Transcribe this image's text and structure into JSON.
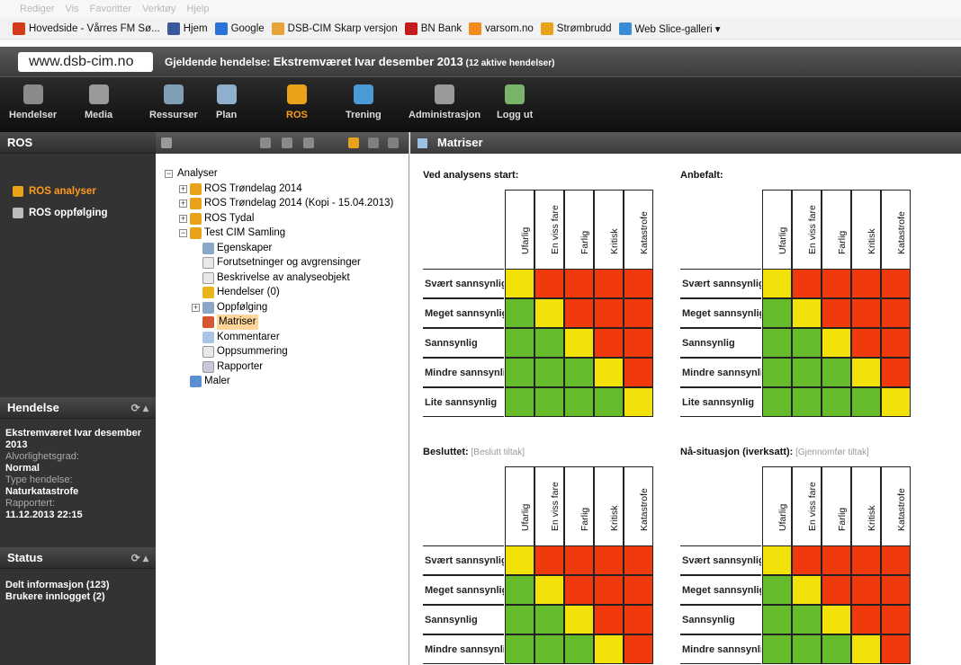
{
  "browser": {
    "menu": [
      "Rediger",
      "Vis",
      "Favoritter",
      "Verktøy",
      "Hjelp"
    ],
    "favorites": [
      {
        "label": "Hovedside - Vårres FM Sø...",
        "icon": "shield-icon",
        "color": "#d23c1d"
      },
      {
        "label": "Hjem",
        "icon": "facebook-icon",
        "color": "#3b5998"
      },
      {
        "label": "Google",
        "icon": "google-icon",
        "color": "#2b73d6"
      },
      {
        "label": "DSB-CIM Skarp versjon",
        "icon": "flag-icon",
        "color": "#e7a33a"
      },
      {
        "label": "BN Bank",
        "icon": "bn-icon",
        "color": "#c61b1b"
      },
      {
        "label": "varsom.no",
        "icon": "v-icon",
        "color": "#f08a1d"
      },
      {
        "label": "Strømbrudd",
        "icon": "plug-icon",
        "color": "#e9a31b"
      },
      {
        "label": "Web Slice-galleri ▾",
        "icon": "ie-icon",
        "color": "#3a8ed6"
      }
    ]
  },
  "site": {
    "url": "www.dsb-cim.no",
    "current_event_prefix": "Gjeldende hendelse: ",
    "current_event": "Ekstremværet Ivar desember 2013",
    "active_count": " (12 aktive hendelser)"
  },
  "toolbar": [
    {
      "label": "Hendelser",
      "icon": "incident-icon",
      "color": "#8a8a8a",
      "active": false
    },
    {
      "label": "Media",
      "icon": "media-icon",
      "color": "#9a9a9a",
      "active": false
    },
    {
      "label": "Ressurser",
      "icon": "globe-icon",
      "color": "#7f9fb5",
      "active": false
    },
    {
      "label": "Plan",
      "icon": "plan-icon",
      "color": "#8fb0cc",
      "active": false
    },
    {
      "label": "ROS",
      "icon": "ros-icon",
      "color": "#e9a31b",
      "active": true
    },
    {
      "label": "Trening",
      "icon": "training-icon",
      "color": "#4a9bd6",
      "active": false
    },
    {
      "label": "Administrasjon",
      "icon": "gear-icon",
      "color": "#9a9a9a",
      "active": false
    },
    {
      "label": "Logg ut",
      "icon": "logout-icon",
      "color": "#7ab36a",
      "active": false
    }
  ],
  "left": {
    "title": "ROS",
    "items": [
      {
        "label": "ROS analyser",
        "active": true
      },
      {
        "label": "ROS oppfølging",
        "active": false
      }
    ],
    "event_title": "Hendelse",
    "event_name": "Ekstremværet Ivar desember 2013",
    "severity_label": "Alvorlighetsgrad:",
    "severity_value": "Normal",
    "type_label": "Type hendelse:",
    "type_value": "Naturkatastrofe",
    "reported_label": "Rapportert:",
    "reported_value": "11.12.2013 22:15",
    "status_title": "Status",
    "status_items": [
      "Delt informasjon (123)",
      "Brukere innlogget (2)"
    ]
  },
  "tree": [
    {
      "label": "Analyser",
      "depth": 0,
      "toggle": "−",
      "icon": ""
    },
    {
      "label": "ROS Trøndelag 2014",
      "depth": 1,
      "toggle": "+",
      "icon": "folder"
    },
    {
      "label": "ROS Trøndelag 2014 (Kopi - 15.04.2013)",
      "depth": 1,
      "toggle": "+",
      "icon": "folder"
    },
    {
      "label": "ROS Tydal",
      "depth": 1,
      "toggle": "+",
      "icon": "folder"
    },
    {
      "label": "Test CIM Samling",
      "depth": 1,
      "toggle": "−",
      "icon": "folder"
    },
    {
      "label": "Egenskaper",
      "depth": 2,
      "toggle": "",
      "icon": "gear"
    },
    {
      "label": "Forutsetninger og avgrensinger",
      "depth": 2,
      "toggle": "",
      "icon": "doc"
    },
    {
      "label": "Beskrivelse av analyseobjekt",
      "depth": 2,
      "toggle": "",
      "icon": "doc"
    },
    {
      "label": "Hendelser (0)",
      "depth": 2,
      "toggle": "",
      "icon": "people"
    },
    {
      "label": "Oppfølging",
      "depth": 2,
      "toggle": "+",
      "icon": "gears"
    },
    {
      "label": "Matriser",
      "depth": 2,
      "toggle": "",
      "icon": "matrix",
      "selected": true
    },
    {
      "label": "Kommentarer",
      "depth": 2,
      "toggle": "",
      "icon": "comment"
    },
    {
      "label": "Oppsummering",
      "depth": 2,
      "toggle": "",
      "icon": "doc"
    },
    {
      "label": "Rapporter",
      "depth": 2,
      "toggle": "",
      "icon": "report"
    },
    {
      "label": "Maler",
      "depth": 1,
      "toggle": "",
      "icon": "templates"
    }
  ],
  "right": {
    "title": "Matriser",
    "columns": [
      "Ufarlig",
      "En viss fare",
      "Farlig",
      "Kritisk",
      "Katastrofe"
    ],
    "rows": [
      "Svært sannsynlig",
      "Meget sannsynlig",
      "Sannsynlig",
      "Mindre sannsynlig",
      "Lite sannsynlig"
    ],
    "colors": {
      "G": "#66bb2a",
      "Y": "#f2e20a",
      "R": "#f03a0e"
    },
    "matrix": [
      [
        "Y",
        "R",
        "R",
        "R",
        "R"
      ],
      [
        "G",
        "Y",
        "R",
        "R",
        "R"
      ],
      [
        "G",
        "G",
        "Y",
        "R",
        "R"
      ],
      [
        "G",
        "G",
        "G",
        "Y",
        "R"
      ],
      [
        "G",
        "G",
        "G",
        "G",
        "Y"
      ]
    ],
    "blocks": [
      {
        "title": "Ved analysens start:",
        "sub": "",
        "visible_rows": 5
      },
      {
        "title": "Anbefalt:",
        "sub": "",
        "visible_rows": 5
      },
      {
        "title": "Besluttet:",
        "sub": " [Beslutt tiltak]",
        "visible_rows": 4
      },
      {
        "title": "Nå-situasjon (iverksatt):",
        "sub": " [Gjennomfør tiltak]",
        "visible_rows": 4
      }
    ]
  }
}
